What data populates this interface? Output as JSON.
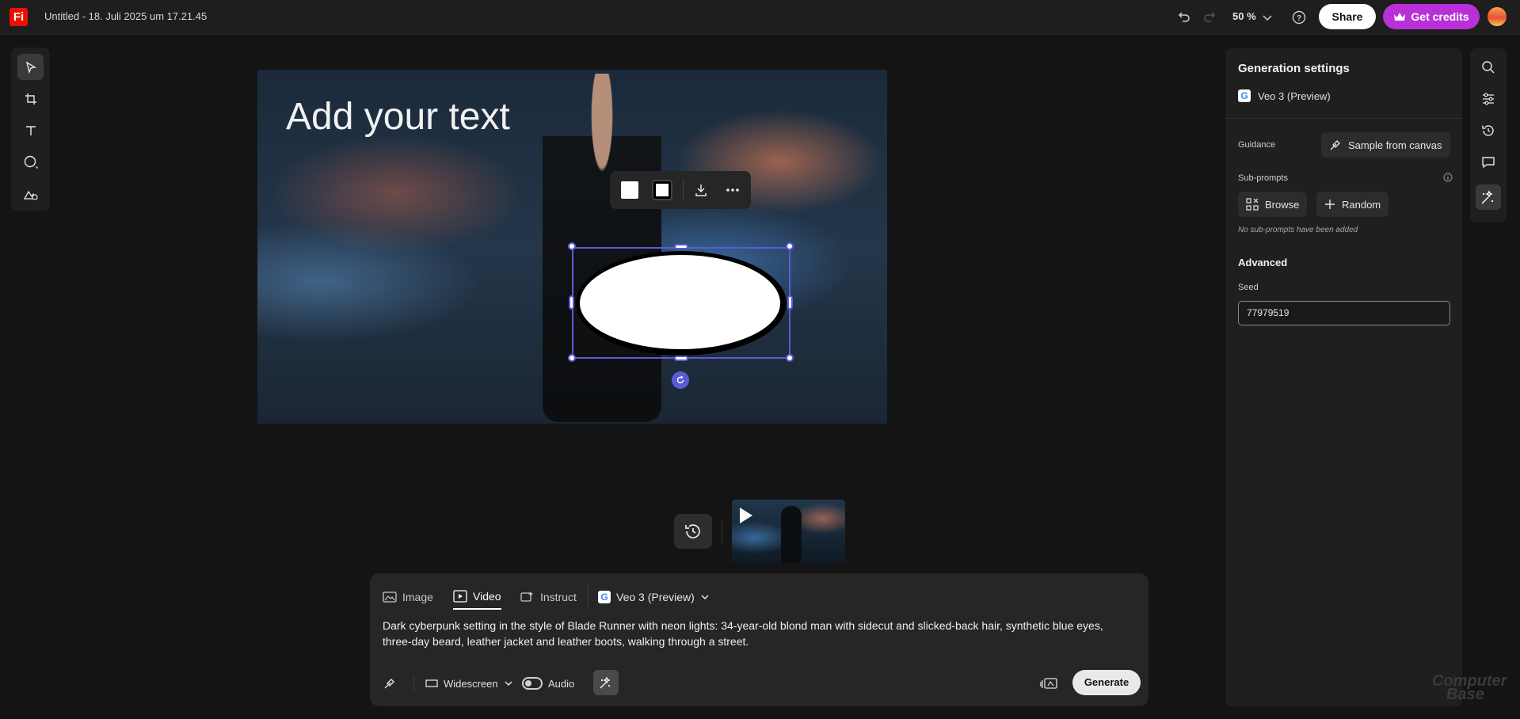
{
  "app": {
    "logo_text": "Fi",
    "document_title": "Untitled - 18. Juli 2025 um 17.21.45",
    "zoom": "50 %",
    "share_label": "Share",
    "credits_label": "Get credits",
    "brand_color": "#eb1000",
    "credits_color": "#b930d8"
  },
  "tools": [
    {
      "name": "select",
      "icon": "arrow-pointer-icon"
    },
    {
      "name": "crop",
      "icon": "crop-icon"
    },
    {
      "name": "text",
      "icon": "text-icon"
    },
    {
      "name": "shape",
      "icon": "circle-shape-icon"
    },
    {
      "name": "generate-fill",
      "icon": "image-edit-icon"
    }
  ],
  "canvas": {
    "text_placeholder": "Add your text",
    "selection_color": "#5b5bd6"
  },
  "prompt_panel": {
    "tabs": [
      "Image",
      "Video",
      "Instruct"
    ],
    "active_tab": "Video",
    "model_label": "Veo 3 (Preview)",
    "prompt_text": "Dark cyberpunk setting in the style of Blade Runner with neon lights: 34-year-old blond man with sidecut and slicked-back hair, synthetic blue eyes, three-day beard, leather jacket and leather boots, walking through a street.",
    "aspect_label": "Widescreen",
    "audio_label": "Audio",
    "generate_label": "Generate"
  },
  "settings": {
    "title": "Generation settings",
    "model": "Veo 3 (Preview)",
    "guidance_label": "Guidance",
    "sample_button": "Sample from canvas",
    "subprompts_label": "Sub-prompts",
    "browse_label": "Browse",
    "random_label": "Random",
    "no_subprompts": "No sub-prompts have been added",
    "advanced_label": "Advanced",
    "seed_label": "Seed",
    "seed_value": "77979519"
  },
  "watermark": {
    "line1": "Computer",
    "line2": "Base"
  }
}
